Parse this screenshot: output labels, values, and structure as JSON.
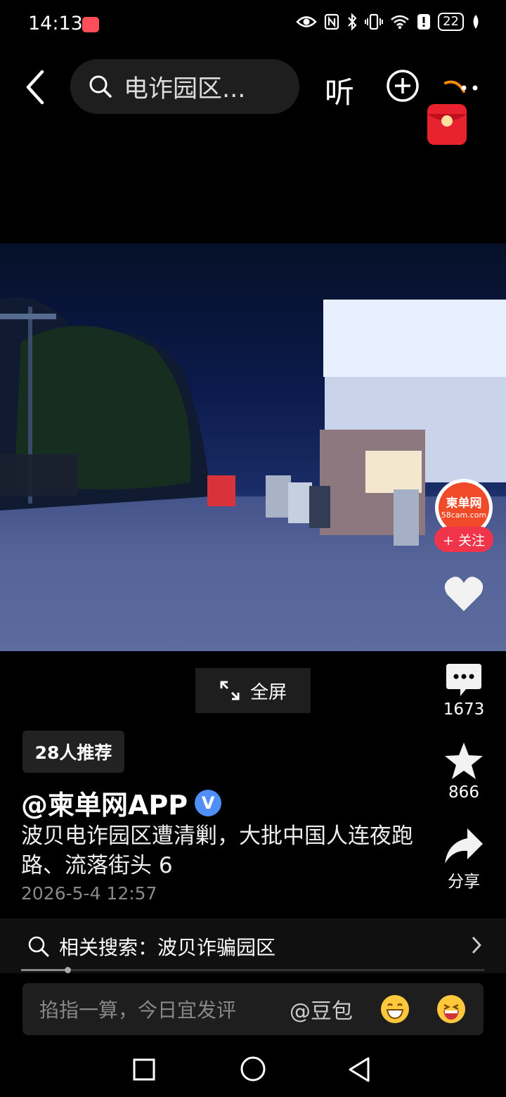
{
  "status_bar": {
    "time": "14:13",
    "battery": "22"
  },
  "top_bar": {
    "search_text": "电诈园区...",
    "listen_label": "听"
  },
  "video": {
    "follow_avatar_line1": "柬单网",
    "follow_avatar_line2": "58cam.com",
    "follow_label": "+ 关注",
    "fullscreen_label": "全屏"
  },
  "side_actions": {
    "comments": "1673",
    "favorites": "866",
    "share_label": "分享"
  },
  "post": {
    "recommend_badge": "28人推荐",
    "author": "@柬单网APP",
    "verified_mark": "V",
    "caption": "波贝电诈园区遭清剿，大批中国人连夜跑路、流落街头 6",
    "date": "2026-5-4 12:57"
  },
  "related_search": {
    "label": "相关搜索：波贝诈骗园区"
  },
  "playback": {
    "progress_fraction": 0.1
  },
  "comment_input": {
    "placeholder": "掐指一算，今日宜发评",
    "mention": "@豆包"
  },
  "colors": {
    "accent_red": "#f0354a",
    "verified_blue": "#4f8ff7"
  }
}
